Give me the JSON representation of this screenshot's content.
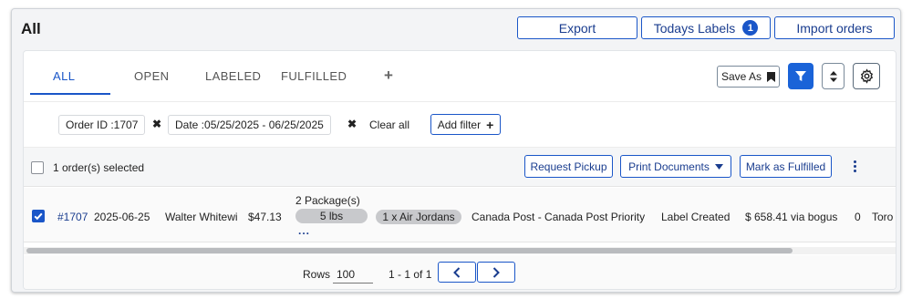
{
  "page": {
    "title": "All"
  },
  "header_buttons": {
    "export": "Export",
    "todays_labels": "Todays Labels",
    "todays_labels_count": "1",
    "import_orders": "Import orders"
  },
  "tabs": [
    {
      "label": "ALL",
      "active": true
    },
    {
      "label": "OPEN",
      "active": false
    },
    {
      "label": "LABELED",
      "active": false
    },
    {
      "label": "FULFILLED",
      "active": false
    }
  ],
  "tab_add_symbol": "+",
  "toolbar": {
    "save_as": "Save As"
  },
  "filters": {
    "chips": [
      {
        "label": "Order ID :1707"
      },
      {
        "label": "Date :05/25/2025 - 06/25/2025"
      }
    ],
    "remove_symbol": "✖",
    "clear_all": "Clear all",
    "add_filter": "Add filter",
    "add_symbol": "+"
  },
  "selection": {
    "text": "1 order(s) selected",
    "request_pickup": "Request Pickup",
    "print_documents": "Print Documents",
    "mark_fulfilled": "Mark as Fulfilled"
  },
  "orders": [
    {
      "checked": true,
      "order_number": "#1707",
      "date": "2025-06-25",
      "customer": "Walter Whitewi",
      "total": "$47.13",
      "packages_heading": "2 Package(s)",
      "package_weight": "5 lbs",
      "package_more": "...",
      "items": "1 x Air Jordans",
      "shipping_service": "Canada Post - Canada Post Priority",
      "status": "Label Created",
      "rate": "$ 658.41 via bogus",
      "count": "0",
      "city": "Toro"
    }
  ],
  "pagination": {
    "rows_label": "Rows",
    "rows_value": "100",
    "range_text": "1 - 1 of 1"
  },
  "colors": {
    "accent": "#1a56c8",
    "link": "#1a3d8f",
    "pill": "#c8c9cc"
  }
}
